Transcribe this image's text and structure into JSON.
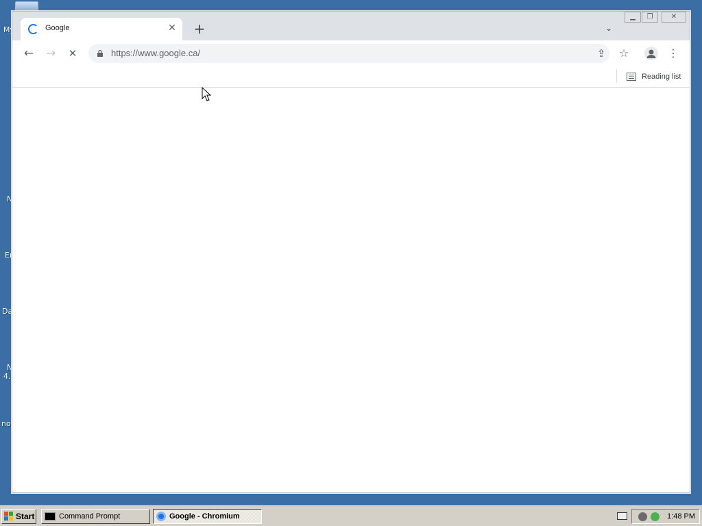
{
  "desktop": {
    "fragments": [
      "My",
      "N",
      "Er",
      "Da",
      "N",
      "4.",
      "not"
    ]
  },
  "browser": {
    "tab": {
      "title": "Google",
      "close_glyph": "✕",
      "status": "loading"
    },
    "new_tab_glyph": "+",
    "tab_search_glyph": "⌄",
    "window_controls": {
      "minimize": "▁",
      "restore": "❐",
      "close": "✕"
    },
    "toolbar": {
      "back_glyph": "←",
      "forward_glyph": "→",
      "stop_glyph": "✕",
      "url": "https://www.google.ca/",
      "share_glyph": "⇪",
      "bookmark_glyph": "☆",
      "menu_glyph": "⋮"
    },
    "bookmarks_bar": {
      "reading_list": "Reading list"
    }
  },
  "taskbar": {
    "start_label": "Start",
    "items": [
      {
        "label": "Command Prompt",
        "active": false
      },
      {
        "label": "Google - Chromium",
        "active": true
      }
    ],
    "clock": "1:48 PM"
  },
  "colors": {
    "desktop": "#3a6ea5",
    "tabstrip": "#dee1e6",
    "accent": "#1a73e8",
    "taskbar": "#d4d0c8"
  }
}
